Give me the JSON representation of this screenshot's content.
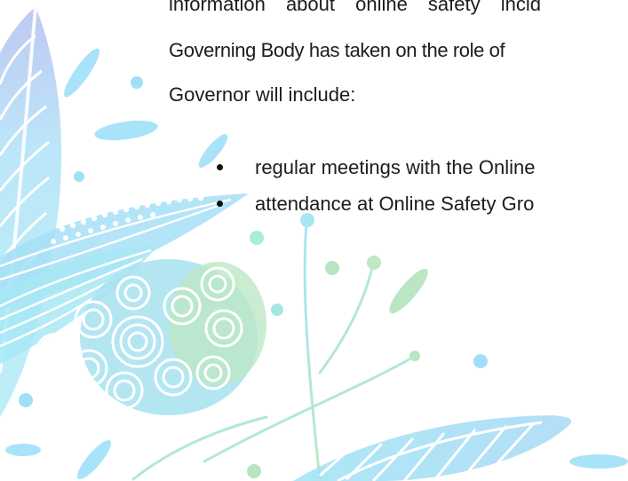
{
  "document": {
    "paragraph_lines": [
      "information about online safety incid",
      "Governing Body has taken on the role of",
      "Governor will include:"
    ],
    "bullets": [
      "regular meetings with the Online",
      "attendance at Online Safety Gro"
    ]
  },
  "colors": {
    "text": "#1c1c1c",
    "decor_blue": "#9fe0f8",
    "decor_cyan": "#a8ecf4",
    "decor_green": "#b8e6c2",
    "decor_lilac": "#a9b7ee"
  }
}
